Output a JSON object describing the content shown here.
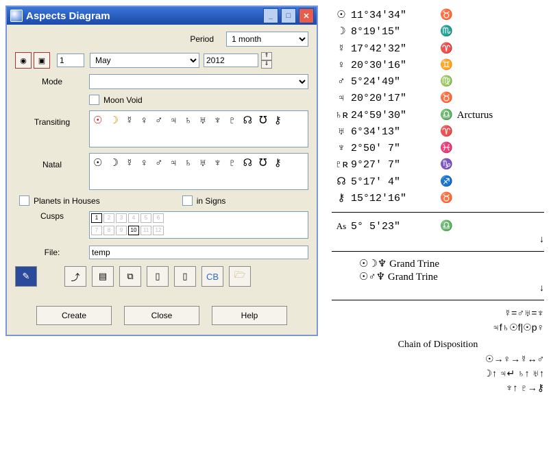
{
  "window": {
    "title": "Aspects Diagram",
    "labels": {
      "period": "Period",
      "mode": "Mode",
      "moon_void": "Moon Void",
      "transiting": "Transiting",
      "natal": "Natal",
      "planets_in_houses": "Planets in Houses",
      "in_signs": "in Signs",
      "cusps": "Cusps",
      "file": "File:"
    },
    "values": {
      "period_selected": "1 month",
      "day": "1",
      "month": "May",
      "year": "2012",
      "mode_selected": "",
      "file": "temp",
      "transiting_glyphs": "☉ ☽ ☿ ♀ ♂ ♃ ♄ ♅ ♆ ♇ ☊ ℧ ⚷",
      "natal_glyphs": "☉ ☽ ☿ ♀ ♂ ♃ ♄ ♅ ♆ ♇ ☊ ℧ ⚷"
    },
    "cusps_on": [
      "1",
      "10"
    ],
    "cusps_all": [
      "1",
      "2",
      "3",
      "4",
      "5",
      "6",
      "7",
      "8",
      "9",
      "10",
      "11",
      "12"
    ],
    "buttons": {
      "create": "Create",
      "close": "Close",
      "help": "Help"
    }
  },
  "ephemeris": {
    "rows": [
      {
        "sym": "☉",
        "pos": "11°34'34\"",
        "sign": "♉",
        "note": ""
      },
      {
        "sym": "☽",
        "pos": " 8°19'15\"",
        "sign": "♏",
        "note": ""
      },
      {
        "sym": "☿",
        "pos": "17°42'32\"",
        "sign": "♈",
        "note": ""
      },
      {
        "sym": "♀",
        "pos": "20°30'16\"",
        "sign": "♊",
        "note": ""
      },
      {
        "sym": "♂",
        "pos": " 5°24'49\"",
        "sign": "♍",
        "note": ""
      },
      {
        "sym": "♃",
        "pos": "20°20'17\"",
        "sign": "♉",
        "note": ""
      },
      {
        "sym": "♄ʀ",
        "pos": "24°59'30\"",
        "sign": "♎",
        "note": "Arcturus"
      },
      {
        "sym": "♅",
        "pos": " 6°34'13\"",
        "sign": "♈",
        "note": ""
      },
      {
        "sym": "♆",
        "pos": " 2°50' 7\"",
        "sign": "♓",
        "note": ""
      },
      {
        "sym": "♇ʀ",
        "pos": " 9°27' 7\"",
        "sign": "♑",
        "note": ""
      },
      {
        "sym": "☊",
        "pos": " 5°17' 4\"",
        "sign": "♐",
        "note": ""
      },
      {
        "sym": "⚷",
        "pos": "15°12'16\"",
        "sign": "♉",
        "note": ""
      }
    ],
    "asc": {
      "sym": "As",
      "pos": " 5° 5'23\"",
      "sign": "♎"
    },
    "aspects": [
      {
        "glyphs": "☉☽♆",
        "label": "Grand Trine"
      },
      {
        "glyphs": "☉♂♆",
        "label": "Grand Trine"
      }
    ],
    "chain": {
      "line1": "☿=♂♅=♆",
      "line2": "♃f♄☉f|☉p♀",
      "title": "Chain of Disposition",
      "line3": "☉→♀→☿↔♂",
      "line4": "☽↑ ♃↵    ♄↑ ♅↑",
      "line5": "♆↑ ♇→⚷"
    }
  }
}
